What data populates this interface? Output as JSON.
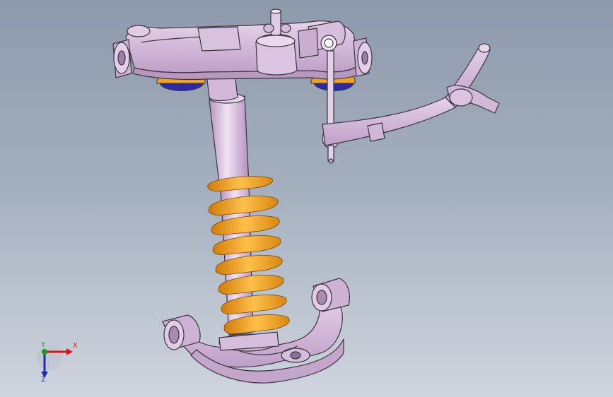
{
  "viewport": {
    "background_top": "#8d9aab",
    "background_bottom": "#cfd5de"
  },
  "colors": {
    "part_body": "#d8bedd",
    "part_shadow": "#b89ac0",
    "part_edge": "#3b3440",
    "spring": "#f2a21c",
    "spring_shade": "#d17c0a",
    "mount_top": "#f2a21c",
    "mount_bottom": "#2a2aa8"
  },
  "triad": {
    "x_label": "X",
    "y_label": "Y",
    "z_label": "Z",
    "x_color": "#d21818",
    "y_color": "#1a9a1a",
    "z_color": "#1c2ea8"
  }
}
